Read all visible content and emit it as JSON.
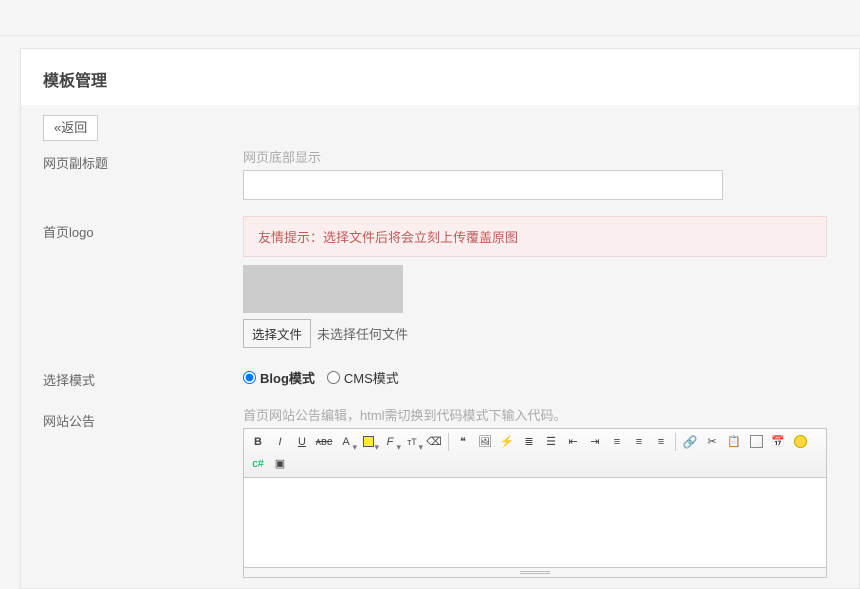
{
  "page_title": "模板管理",
  "back_button": "«返回",
  "fields": {
    "subtitle_label": "网页副标题",
    "subtitle_hint": "网页底部显示",
    "subtitle_value": "",
    "logo_label": "首页logo",
    "logo_alert": "友情提示：选择文件后将会立刻上传覆盖原图",
    "file_button": "选择文件",
    "file_status": "未选择任何文件",
    "mode_label": "选择模式",
    "mode_blog": "Blog模式",
    "mode_cms": "CMS模式",
    "mode_selected": "blog",
    "announce_label": "网站公告",
    "announce_hint": "首页网站公告编辑，html需切换到代码模式下输入代码。"
  },
  "editor_icons": [
    "bold",
    "italic",
    "underline",
    "strikethrough",
    "fontcolor",
    "bgcolor",
    "fontfamily",
    "fontsize",
    "removeformat",
    "blockquote",
    "image",
    "flash",
    "orderedlist",
    "unorderedlist",
    "outdent",
    "indent",
    "alignleft",
    "aligncenter",
    "alignright",
    "link",
    "unlink",
    "paste",
    "table",
    "date",
    "smiley",
    "code",
    "more"
  ]
}
